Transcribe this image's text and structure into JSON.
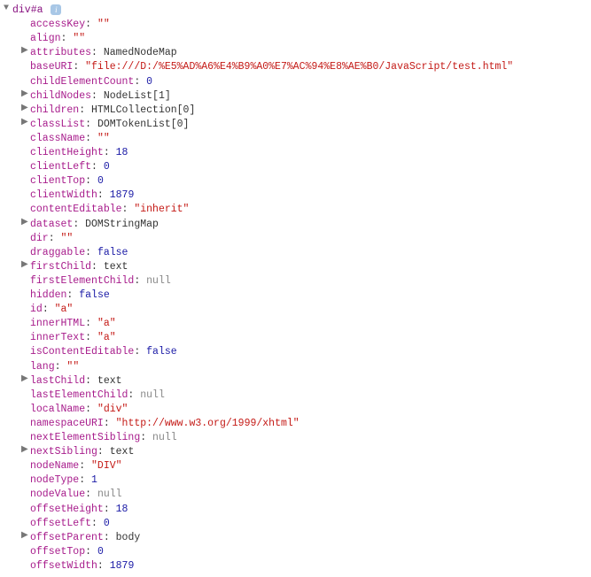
{
  "header": {
    "summary": "div#a",
    "expanded": true
  },
  "properties": [
    {
      "name": "accessKey",
      "value": "\"\"",
      "type": "string",
      "expandable": false
    },
    {
      "name": "align",
      "value": "\"\"",
      "type": "string",
      "expandable": false
    },
    {
      "name": "attributes",
      "value": "NamedNodeMap",
      "type": "obj",
      "expandable": true
    },
    {
      "name": "baseURI",
      "value": "\"file:///D:/%E5%AD%A6%E4%B9%A0%E7%AC%94%E8%AE%B0/JavaScript/test.html\"",
      "type": "string",
      "expandable": false
    },
    {
      "name": "childElementCount",
      "value": "0",
      "type": "num",
      "expandable": false
    },
    {
      "name": "childNodes",
      "value": "NodeList[1]",
      "type": "obj",
      "expandable": true
    },
    {
      "name": "children",
      "value": "HTMLCollection[0]",
      "type": "obj",
      "expandable": true
    },
    {
      "name": "classList",
      "value": "DOMTokenList[0]",
      "type": "obj",
      "expandable": true
    },
    {
      "name": "className",
      "value": "\"\"",
      "type": "string",
      "expandable": false
    },
    {
      "name": "clientHeight",
      "value": "18",
      "type": "num",
      "expandable": false
    },
    {
      "name": "clientLeft",
      "value": "0",
      "type": "num",
      "expandable": false
    },
    {
      "name": "clientTop",
      "value": "0",
      "type": "num",
      "expandable": false
    },
    {
      "name": "clientWidth",
      "value": "1879",
      "type": "num",
      "expandable": false
    },
    {
      "name": "contentEditable",
      "value": "\"inherit\"",
      "type": "string",
      "expandable": false
    },
    {
      "name": "dataset",
      "value": "DOMStringMap",
      "type": "obj",
      "expandable": true
    },
    {
      "name": "dir",
      "value": "\"\"",
      "type": "string",
      "expandable": false
    },
    {
      "name": "draggable",
      "value": "false",
      "type": "bool",
      "expandable": false
    },
    {
      "name": "firstChild",
      "value": "text",
      "type": "obj",
      "expandable": true
    },
    {
      "name": "firstElementChild",
      "value": "null",
      "type": "null",
      "expandable": false
    },
    {
      "name": "hidden",
      "value": "false",
      "type": "bool",
      "expandable": false
    },
    {
      "name": "id",
      "value": "\"a\"",
      "type": "string",
      "expandable": false
    },
    {
      "name": "innerHTML",
      "value": "\"a\"",
      "type": "string",
      "expandable": false
    },
    {
      "name": "innerText",
      "value": "\"a\"",
      "type": "string",
      "expandable": false
    },
    {
      "name": "isContentEditable",
      "value": "false",
      "type": "bool",
      "expandable": false
    },
    {
      "name": "lang",
      "value": "\"\"",
      "type": "string",
      "expandable": false
    },
    {
      "name": "lastChild",
      "value": "text",
      "type": "obj",
      "expandable": true
    },
    {
      "name": "lastElementChild",
      "value": "null",
      "type": "null",
      "expandable": false
    },
    {
      "name": "localName",
      "value": "\"div\"",
      "type": "string",
      "expandable": false
    },
    {
      "name": "namespaceURI",
      "value": "\"http://www.w3.org/1999/xhtml\"",
      "type": "string",
      "expandable": false
    },
    {
      "name": "nextElementSibling",
      "value": "null",
      "type": "null",
      "expandable": false
    },
    {
      "name": "nextSibling",
      "value": "text",
      "type": "obj",
      "expandable": true
    },
    {
      "name": "nodeName",
      "value": "\"DIV\"",
      "type": "string",
      "expandable": false
    },
    {
      "name": "nodeType",
      "value": "1",
      "type": "num",
      "expandable": false
    },
    {
      "name": "nodeValue",
      "value": "null",
      "type": "null",
      "expandable": false
    },
    {
      "name": "offsetHeight",
      "value": "18",
      "type": "num",
      "expandable": false
    },
    {
      "name": "offsetLeft",
      "value": "0",
      "type": "num",
      "expandable": false
    },
    {
      "name": "offsetParent",
      "value": "body",
      "type": "obj",
      "expandable": true
    },
    {
      "name": "offsetTop",
      "value": "0",
      "type": "num",
      "expandable": false
    },
    {
      "name": "offsetWidth",
      "value": "1879",
      "type": "num",
      "expandable": false
    }
  ]
}
